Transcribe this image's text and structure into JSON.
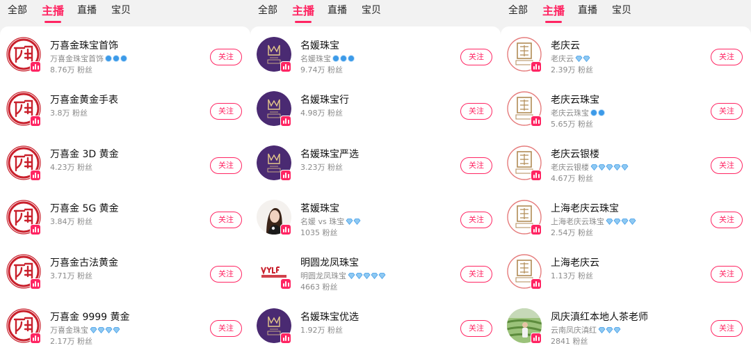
{
  "tabs": [
    {
      "all": "全部",
      "anchor": "主播",
      "live": "直播",
      "goods": "宝贝"
    },
    {
      "all": "全部",
      "anchor": "主播",
      "live": "直播",
      "goods": "宝贝"
    },
    {
      "all": "全部",
      "anchor": "主播",
      "live": "直播",
      "goods": "宝贝"
    }
  ],
  "follow_label": "关注",
  "colors": {
    "accent": "#ff2462",
    "badge_blue": "#3c9ae8",
    "muted": "#8a8a8a"
  },
  "columns": [
    {
      "anchors": [
        {
          "name": "万喜金珠宝首饰",
          "shop": "万喜金珠宝首饰",
          "badge": "level-circle",
          "badge_count": 3,
          "fans": "8.76万 粉丝",
          "avatar": "wanxijin-seal"
        },
        {
          "name": "万喜金黄金手表",
          "shop": "",
          "badge": "",
          "badge_count": 0,
          "fans": "3.8万 粉丝",
          "avatar": "wanxijin-seal"
        },
        {
          "name": "万喜金 3D 黄金",
          "shop": "",
          "badge": "",
          "badge_count": 0,
          "fans": "4.23万 粉丝",
          "avatar": "wanxijin-seal"
        },
        {
          "name": "万喜金 5G 黄金",
          "shop": "",
          "badge": "",
          "badge_count": 0,
          "fans": "3.84万 粉丝",
          "avatar": "wanxijin-seal"
        },
        {
          "name": "万喜金古法黄金",
          "shop": "",
          "badge": "",
          "badge_count": 0,
          "fans": "3.71万 粉丝",
          "avatar": "wanxijin-seal"
        },
        {
          "name": "万喜金 9999 黄金",
          "shop": "万喜金珠宝",
          "badge": "diamond",
          "badge_count": 4,
          "fans": "2.17万 粉丝",
          "avatar": "wanxijin-seal"
        }
      ]
    },
    {
      "anchors": [
        {
          "name": "名媛珠宝",
          "shop": "名媛珠宝",
          "badge": "level-circle",
          "badge_count": 3,
          "fans": "9.74万 粉丝",
          "avatar": "mingyuan-logo"
        },
        {
          "name": "名媛珠宝行",
          "shop": "",
          "badge": "",
          "badge_count": 0,
          "fans": "4.98万 粉丝",
          "avatar": "mingyuan-logo"
        },
        {
          "name": "名媛珠宝严选",
          "shop": "",
          "badge": "",
          "badge_count": 0,
          "fans": "3.23万 粉丝",
          "avatar": "mingyuan-logo"
        },
        {
          "name": "茗媛珠宝",
          "shop": "名媛 vs 珠宝",
          "badge": "diamond",
          "badge_count": 2,
          "fans": "1035 粉丝",
          "avatar": "woman-photo"
        },
        {
          "name": "明圆龙凤珠宝",
          "shop": "明圆龙凤珠宝",
          "badge": "diamond",
          "badge_count": 5,
          "fans": "4663 粉丝",
          "avatar": "mylf-logo"
        },
        {
          "name": "名媛珠宝优选",
          "shop": "",
          "badge": "",
          "badge_count": 0,
          "fans": "1.92万 粉丝",
          "avatar": "mingyuan-logo"
        }
      ]
    },
    {
      "anchors": [
        {
          "name": "老庆云",
          "shop": "老庆云",
          "badge": "diamond",
          "badge_count": 2,
          "fans": "2.39万 粉丝",
          "avatar": "laoqingyun-logo"
        },
        {
          "name": "老庆云珠宝",
          "shop": "老庆云珠宝",
          "badge": "level-circle",
          "badge_count": 2,
          "fans": "5.65万 粉丝",
          "avatar": "laoqingyun-logo"
        },
        {
          "name": "老庆云银楼",
          "shop": "老庆云银楼",
          "badge": "diamond",
          "badge_count": 5,
          "fans": "4.67万 粉丝",
          "avatar": "laoqingyun-logo"
        },
        {
          "name": "上海老庆云珠宝",
          "shop": "上海老庆云珠宝",
          "badge": "diamond",
          "badge_count": 4,
          "fans": "2.54万 粉丝",
          "avatar": "laoqingyun-logo"
        },
        {
          "name": "上海老庆云",
          "shop": "",
          "badge": "",
          "badge_count": 0,
          "fans": "1.13万 粉丝",
          "avatar": "laoqingyun-logo"
        },
        {
          "name": "凤庆滇红本地人茶老师",
          "shop": "云南凤庆滇红",
          "badge": "diamond",
          "badge_count": 3,
          "fans": "2841 粉丝",
          "avatar": "tea-field-photo"
        }
      ]
    }
  ]
}
